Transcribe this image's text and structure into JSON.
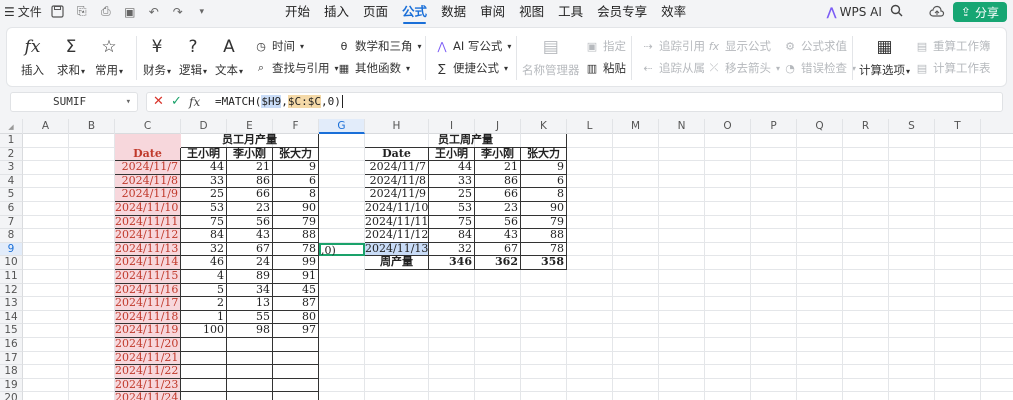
{
  "titlebar": {
    "file_label": "文件",
    "menu_items": [
      "开始",
      "插入",
      "页面",
      "公式",
      "数据",
      "审阅",
      "视图",
      "工具",
      "会员专享",
      "效率"
    ],
    "active_menu": "公式",
    "wps_ai": "WPS AI",
    "share_label": "分享",
    "share_color": "#17a673"
  },
  "ribbon": {
    "insert": "插入",
    "sum": "求和",
    "common": "常用",
    "finance": "财务",
    "logic": "逻辑",
    "text": "文本",
    "time": "时间",
    "lookup": "查找与引用",
    "math": "数学和三角",
    "other": "其他函数",
    "ai_formula": "AI 写公式",
    "quick_formula": "便捷公式",
    "name_manager": "名称管理器",
    "assign": "指定",
    "paste": "粘贴",
    "trace_precedents": "追踪引用",
    "trace_dependents": "追踪从属",
    "show_formulas": "显示公式",
    "remove_arrows": "移去箭头",
    "eval_formula": "公式求值",
    "error_check": "错误检查",
    "calc_options": "计算选项",
    "recalc_workbook": "重算工作簿",
    "calc_sheet": "计算工作表"
  },
  "formula_bar": {
    "name_box": "SUMIF",
    "formula_prefix": "=MATCH(",
    "ref1": "$H9",
    "comma1": ",",
    "ref2": "$C:$C",
    "formula_suffix": ",0)"
  },
  "columns": [
    "A",
    "B",
    "C",
    "D",
    "E",
    "F",
    "G",
    "H",
    "I",
    "J",
    "K",
    "L",
    "M",
    "N",
    "O",
    "P",
    "Q",
    "R",
    "S",
    "T"
  ],
  "rows": [
    "1",
    "2",
    "3",
    "4",
    "5",
    "6",
    "7",
    "8",
    "9",
    "10",
    "11",
    "12",
    "13",
    "14",
    "15",
    "16",
    "17",
    "18",
    "19",
    "20"
  ],
  "monthly": {
    "title": "员工月产量",
    "headers": [
      "Date",
      "王小明",
      "李小刚",
      "张大力"
    ],
    "rows": [
      [
        "2024/11/7",
        "44",
        "21",
        "9"
      ],
      [
        "2024/11/8",
        "33",
        "86",
        "6"
      ],
      [
        "2024/11/9",
        "25",
        "66",
        "8"
      ],
      [
        "2024/11/10",
        "53",
        "23",
        "90"
      ],
      [
        "2024/11/11",
        "75",
        "56",
        "79"
      ],
      [
        "2024/11/12",
        "84",
        "43",
        "88"
      ],
      [
        "2024/11/13",
        "32",
        "67",
        "78"
      ],
      [
        "2024/11/14",
        "46",
        "24",
        "99"
      ],
      [
        "2024/11/15",
        "4",
        "89",
        "91"
      ],
      [
        "2024/11/16",
        "5",
        "34",
        "45"
      ],
      [
        "2024/11/17",
        "2",
        "13",
        "87"
      ],
      [
        "2024/11/18",
        "1",
        "55",
        "80"
      ],
      [
        "2024/11/19",
        "100",
        "98",
        "97"
      ],
      [
        "2024/11/20",
        "",
        "",
        ""
      ],
      [
        "2024/11/21",
        "",
        "",
        ""
      ],
      [
        "2024/11/22",
        "",
        "",
        ""
      ],
      [
        "2024/11/23",
        "",
        "",
        ""
      ],
      [
        "2024/11/24",
        "",
        "",
        ""
      ]
    ]
  },
  "weekly": {
    "title": "员工周产量",
    "headers": [
      "Date",
      "王小明",
      "李小刚",
      "张大力"
    ],
    "rows": [
      [
        "2024/11/7",
        "44",
        "21",
        "9"
      ],
      [
        "2024/11/8",
        "33",
        "86",
        "6"
      ],
      [
        "2024/11/9",
        "25",
        "66",
        "8"
      ],
      [
        "2024/11/10",
        "53",
        "23",
        "90"
      ],
      [
        "2024/11/11",
        "75",
        "56",
        "79"
      ],
      [
        "2024/11/12",
        "84",
        "43",
        "88"
      ],
      [
        "2024/11/13",
        "32",
        "67",
        "78"
      ]
    ],
    "total_label": "周产量",
    "totals": [
      "346",
      "362",
      "358"
    ]
  },
  "editing_cell_text": ",0)"
}
